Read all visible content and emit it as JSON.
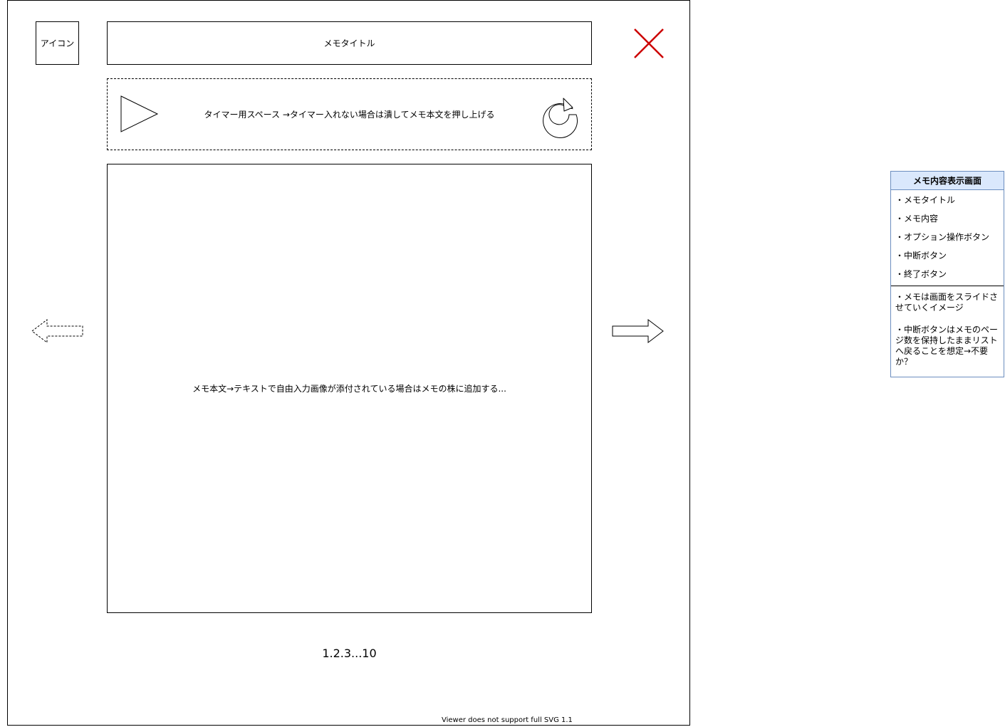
{
  "header": {
    "icon_label": "アイコン",
    "memo_title": "メモタイトル"
  },
  "timer": {
    "text": "タイマー用スペース →タイマー入れない場合は潰してメモ本文を押し上げる"
  },
  "memo_body": {
    "text": "メモ本文→テキストで自由入力画像が添付されている場合はメモの株に追加する..."
  },
  "pagination": {
    "text": "1.2.3...10"
  },
  "viewer_note": "Viewer does not support full SVG 1.1",
  "side_panel": {
    "title": "メモ内容表示画面",
    "items": [
      "・メモタイトル",
      "・メモ内容",
      "・オプション操作ボタン",
      "・中断ボタン",
      "・終了ボタン"
    ],
    "notes": [
      "・メモは画面をスライドさせていくイメージ",
      "・中断ボタンはメモのページ数を保持したままリストへ戻ることを想定→不要か？"
    ]
  },
  "colors": {
    "close_icon": "#cc0000",
    "panel_header_bg": "#dae8fc",
    "panel_border": "#6c8ebf"
  },
  "icons": {
    "close": "close-icon",
    "play": "play-icon",
    "reset": "reset-icon",
    "prev": "arrow-left-icon",
    "next": "arrow-right-icon"
  }
}
